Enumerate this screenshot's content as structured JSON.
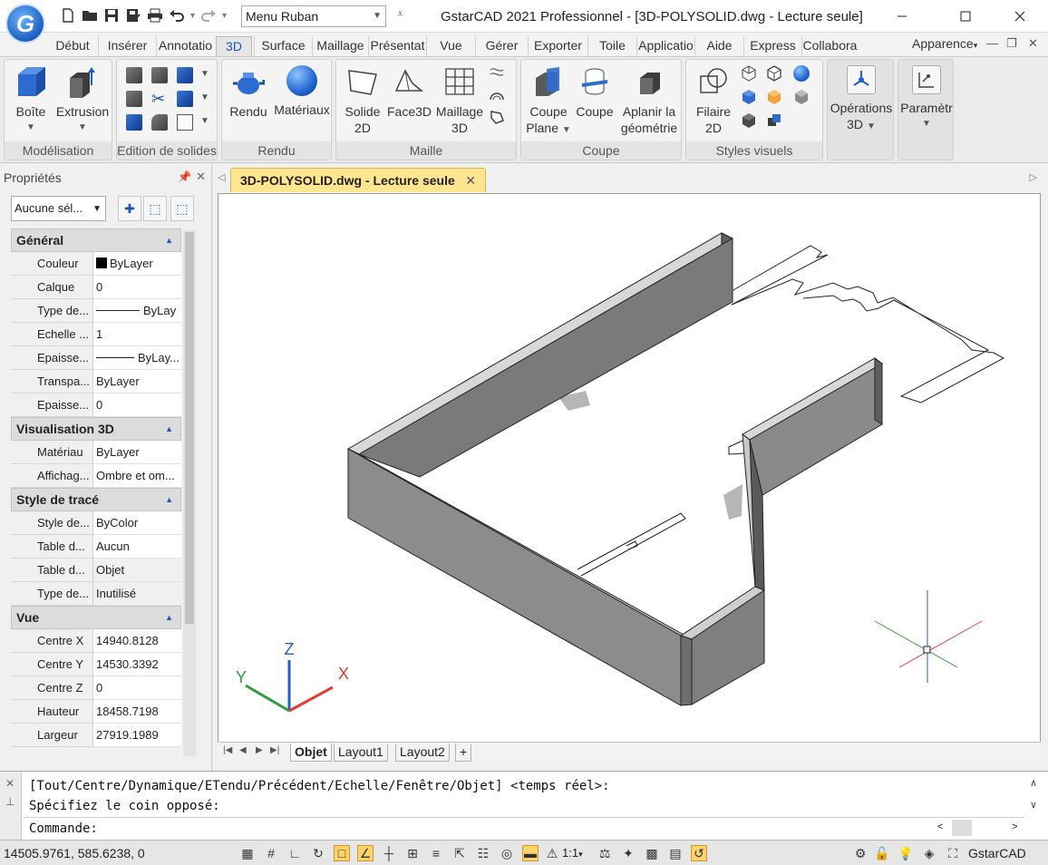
{
  "titlebar": {
    "menu_select": "Menu Ruban",
    "title": "GstarCAD 2021 Professionnel - [3D-POLYSOLID.dwg - Lecture seule]",
    "logo_letter": "G"
  },
  "tabs": [
    "Début",
    "Insérer",
    "Annotatio",
    "3D",
    "Surface",
    "Maillage",
    "Présentat",
    "Vue",
    "Gérer",
    "Exporter",
    "Toile",
    "Applicatio",
    "Aide",
    "Express",
    "Collabora"
  ],
  "active_tab": "3D",
  "apparence": "Apparence",
  "ribbon": {
    "modelisation": {
      "title": "Modélisation",
      "boite": "Boîte",
      "extrusion": "Extrusion"
    },
    "edition": {
      "title": "Edition de solides"
    },
    "rendu": {
      "title": "Rendu",
      "rendu": "Rendu",
      "materiaux": "Matériaux"
    },
    "maille": {
      "title": "Maille",
      "solide_l1": "Solide",
      "solide_l2": "2D",
      "face3d": "Face3D",
      "maillage_l1": "Maillage",
      "maillage_l2": "3D"
    },
    "coupe": {
      "title": "Coupe",
      "coupe_plane_l1": "Coupe",
      "coupe_plane_l2": "Plane",
      "coupe": "Coupe",
      "aplanir_l1": "Aplanir la",
      "aplanir_l2": "géométrie"
    },
    "styles": {
      "title": "Styles visuels",
      "filaire_l1": "Filaire",
      "filaire_l2": "2D"
    },
    "operations": {
      "l1": "Opérations",
      "l2": "3D"
    },
    "parametre": {
      "l1": "Paramètr"
    }
  },
  "properties": {
    "title": "Propriétés",
    "selection": "Aucune sél...",
    "sections": [
      {
        "name": "Général",
        "rows": [
          {
            "k": "Couleur",
            "v": "ByLayer"
          },
          {
            "k": "Calque",
            "v": "0"
          },
          {
            "k": "Type de...",
            "v": "ByLay"
          },
          {
            "k": "Echelle ...",
            "v": "1"
          },
          {
            "k": "Epaisse...",
            "v": "ByLay..."
          },
          {
            "k": "Transpa...",
            "v": "ByLayer"
          },
          {
            "k": "Epaisse...",
            "v": "0"
          }
        ]
      },
      {
        "name": "Visualisation 3D",
        "rows": [
          {
            "k": "Matériau",
            "v": "ByLayer"
          },
          {
            "k": "Affichag...",
            "v": "Ombre et om..."
          }
        ]
      },
      {
        "name": "Style de tracé",
        "rows": [
          {
            "k": "Style de...",
            "v": "ByColor"
          },
          {
            "k": "Table d...",
            "v": "Aucun"
          },
          {
            "k": "Table d...",
            "v": "Objet"
          },
          {
            "k": "Type de...",
            "v": "Inutilisé"
          }
        ]
      },
      {
        "name": "Vue",
        "rows": [
          {
            "k": "Centre X",
            "v": "14940.8128"
          },
          {
            "k": "Centre Y",
            "v": "14530.3392"
          },
          {
            "k": "Centre Z",
            "v": "0"
          },
          {
            "k": "Hauteur",
            "v": "18458.7198"
          },
          {
            "k": "Largeur",
            "v": "27919.1989"
          }
        ]
      }
    ]
  },
  "document": {
    "tab": "3D-POLYSOLID.dwg - Lecture seule"
  },
  "axis": {
    "x": "X",
    "y": "Y",
    "z": "Z"
  },
  "layouts": {
    "objet": "Objet",
    "layout1": "Layout1",
    "layout2": "Layout2",
    "plus": "+"
  },
  "command": {
    "line1": "[Tout/Centre/Dynamique/ETendu/Précédent/Echelle/Fenêtre/Objet] <temps réel>:",
    "line2": "Spécifiez le coin opposé:",
    "prompt": "Commande:"
  },
  "status": {
    "coords": "14505.9761, 585.6238, 0",
    "scale": "1:1",
    "app": "GstarCAD"
  },
  "colors": {
    "accent": "#1b56b8",
    "doc_tab": "#ffe58f",
    "wall_front": "#8c8c8c",
    "wall_side": "#6e6e6e",
    "axis_x": "#e53935",
    "axis_y": "#2e9e3a",
    "axis_z": "#1e5fd1"
  }
}
